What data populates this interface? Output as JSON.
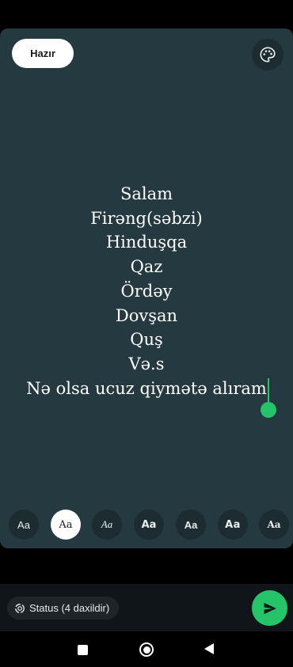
{
  "header": {
    "done_label": "Hazır",
    "palette_icon": "palette-icon"
  },
  "status_text": {
    "lines": [
      "Salam",
      "Firəng(səbzi)",
      "Hinduşqa",
      "Qaz",
      "Ördəy",
      "Dovşan",
      "Quş",
      "Və.s",
      "Nə olsa ucuz qiymətə alıram"
    ],
    "text_color": "#ffffff",
    "background_color": "#243940"
  },
  "cursor": {
    "color": "#25c469"
  },
  "fonts": {
    "options": [
      "Aa",
      "Aa",
      "Aa",
      "Aa",
      "Aa",
      "Aa",
      "Aa"
    ],
    "selected_index": 1
  },
  "bottom": {
    "audience_label": "Status (4 daxildir)",
    "audience_icon": "status-ring-icon",
    "send_icon": "send-icon",
    "accent_color": "#25c469"
  },
  "navbar": {
    "recents_icon": "recents-square-icon",
    "home_icon": "home-circle-icon",
    "back_icon": "back-triangle-icon"
  }
}
